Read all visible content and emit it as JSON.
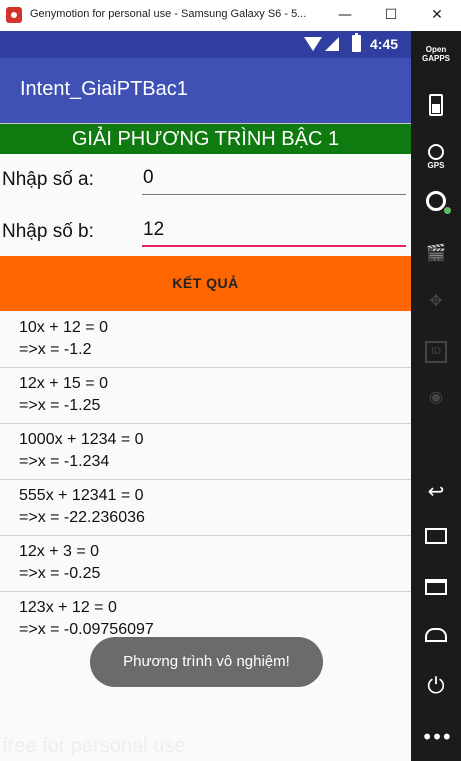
{
  "window": {
    "title": "Genymotion for personal use - Samsung Galaxy S6 - 5...",
    "minimize": "—",
    "maximize": "☐",
    "close": "✕"
  },
  "statusbar": {
    "time": "4:45"
  },
  "app": {
    "title": "Intent_GiaiPTBac1",
    "banner": "GIẢI PHƯƠNG TRÌNH BẬC 1",
    "label_a": "Nhập số a:",
    "value_a": "0",
    "label_b": "Nhập số b:",
    "value_b": "12",
    "result_button": "KẾT QUẢ",
    "history": [
      {
        "equation": "10x + 12 = 0",
        "result": "=>x = -1.2"
      },
      {
        "equation": "12x + 15 = 0",
        "result": "=>x = -1.25"
      },
      {
        "equation": "1000x + 1234 = 0",
        "result": "=>x = -1.234"
      },
      {
        "equation": "555x + 12341 = 0",
        "result": "=>x = -22.236036"
      },
      {
        "equation": "12x + 3 = 0",
        "result": "=>x = -0.25"
      },
      {
        "equation": "123x + 12 = 0",
        "result": "=>x = -0.09756097"
      }
    ],
    "toast": "Phương trình vô nghiệm!",
    "watermark": "free for personal use"
  },
  "sidebar": {
    "opengapps_line1": "Open",
    "opengapps_line2": "GAPPS",
    "gps_label": "GPS",
    "id_label": "ID",
    "back_glyph": "↩",
    "power_glyph": "⏻",
    "more_glyph": "•••",
    "clap_glyph": "🎬",
    "dpad_glyph": "✥",
    "disk_glyph": "◉"
  },
  "colors": {
    "statusbar": "#303f9f",
    "actionbar": "#3f51b5",
    "banner": "#0f7a0f",
    "result_button": "#ff6600",
    "focus_underline": "#e91e63"
  }
}
